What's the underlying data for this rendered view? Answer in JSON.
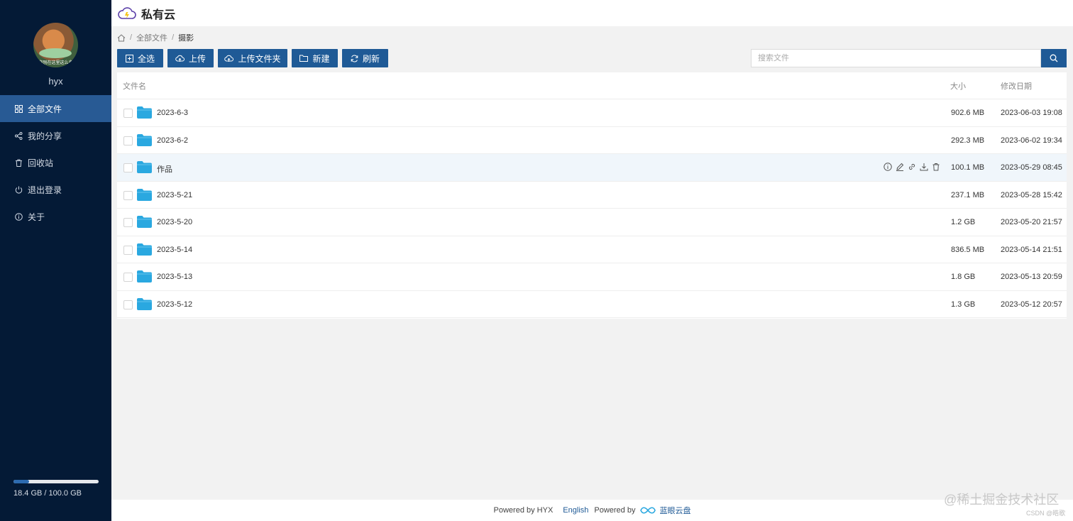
{
  "header": {
    "title": "私有云",
    "logo_icon": "cloud-icon"
  },
  "sidebar": {
    "avatar_caption": "你别在这里这么多",
    "username": "hyx",
    "items": [
      {
        "label": "全部文件",
        "icon": "grid-icon",
        "active": true
      },
      {
        "label": "我的分享",
        "icon": "share-icon",
        "active": false
      },
      {
        "label": "回收站",
        "icon": "trash-icon",
        "active": false
      },
      {
        "label": "退出登录",
        "icon": "power-icon",
        "active": false
      },
      {
        "label": "关于",
        "icon": "info-icon",
        "active": false
      }
    ],
    "storage": {
      "text": "18.4 GB / 100.0 GB",
      "used_fraction": 0.184
    }
  },
  "breadcrumb": {
    "items": [
      "全部文件",
      "摄影"
    ],
    "separator": "/"
  },
  "toolbar": {
    "buttons": [
      {
        "label": "全选",
        "icon": "select-all-icon"
      },
      {
        "label": "上传",
        "icon": "upload-cloud-icon"
      },
      {
        "label": "上传文件夹",
        "icon": "upload-cloud-icon"
      },
      {
        "label": "新建",
        "icon": "folder-icon"
      },
      {
        "label": "刷新",
        "icon": "refresh-icon"
      }
    ]
  },
  "search": {
    "placeholder": "搜索文件",
    "value": ""
  },
  "table": {
    "columns": {
      "name": "文件名",
      "size": "大小",
      "date": "修改日期"
    },
    "rows": [
      {
        "name": "2023-6-3",
        "size": "902.6 MB",
        "date": "2023-06-03 19:08"
      },
      {
        "name": "2023-6-2",
        "size": "292.3 MB",
        "date": "2023-06-02 19:34"
      },
      {
        "name": "作品",
        "size": "100.1 MB",
        "date": "2023-05-29 08:45"
      },
      {
        "name": "2023-5-21",
        "size": "237.1 MB",
        "date": "2023-05-28 15:42"
      },
      {
        "name": "2023-5-20",
        "size": "1.2 GB",
        "date": "2023-05-20 21:57"
      },
      {
        "name": "2023-5-14",
        "size": "836.5 MB",
        "date": "2023-05-14 21:51"
      },
      {
        "name": "2023-5-13",
        "size": "1.8 GB",
        "date": "2023-05-13 20:59"
      },
      {
        "name": "2023-5-12",
        "size": "1.3 GB",
        "date": "2023-05-12 20:57"
      }
    ],
    "row_actions": [
      "info-icon",
      "edit-icon",
      "link-icon",
      "download-icon",
      "delete-icon"
    ]
  },
  "footer": {
    "powered_by": "Powered by HYX",
    "language": "English",
    "powered_by_2": "Powered by",
    "brand": "蓝眼云盘"
  },
  "watermark": {
    "text": "@稀土掘金技术社区",
    "csdn": "CSDN @皓歌"
  },
  "colors": {
    "sidebar_bg": "#041a36",
    "accent": "#1f5a96",
    "active_nav": "#285a94",
    "folder": "#2aa8e0"
  }
}
